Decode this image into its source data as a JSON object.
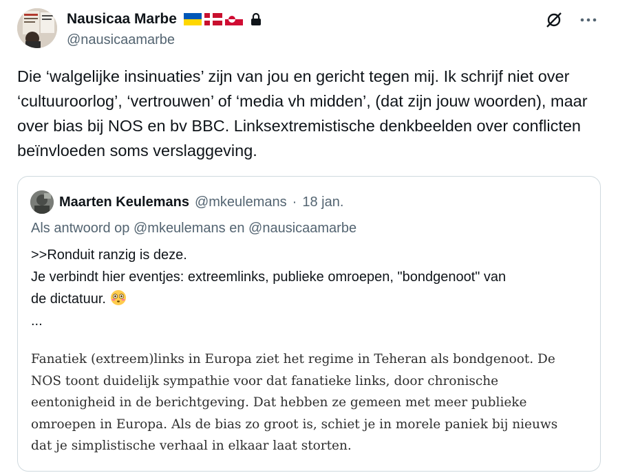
{
  "author": {
    "name": "Nausicaa Marbe",
    "handle": "@nausicaamarbe",
    "flags": [
      "ukraine-flag",
      "denmark-flag",
      "greenland-flag"
    ],
    "protected": true
  },
  "tweet": {
    "text": "Die ‘walgelijke insinuaties’ zijn van jou en gericht tegen mij. Ik schrijf niet over ‘cultuuroorlog’, ‘vertrouwen’ of ‘media vh midden’, (dat zijn jouw woorden), maar over bias bij NOS en bv BBC. Linksextremistische denkbeelden over conflicten beïnvloeden soms verslaggeving."
  },
  "quote": {
    "name": "Maarten Keulemans",
    "handle": "@mkeulemans",
    "separator": "·",
    "date": "18 jan.",
    "reply_to": "Als antwoord op @mkeulemans en @nausicaamarbe",
    "lines": [
      ">>Ronduit ranzig is deze.",
      "Je verbindt hier eventjes: extreemlinks, publieke omroepen, \"bondgenoot\" van",
      "de dictatuur.",
      "..."
    ],
    "emoji": "flushed-face",
    "image_text": [
      "Fanatiek (extreem)links in Europa ziet het regime in Teheran als bondgenoot. De",
      "NOS toont duidelijk sympathie voor dat fanatieke links, door chronische",
      "eentonigheid in de berichtgeving. Dat hebben ze gemeen met meer publieke",
      "omroepen in Europa. Als de bias zo groot is, schiet je in morele paniek bij nieuws",
      "dat je simplistische verhaal in elkaar laat storten."
    ]
  },
  "colors": {
    "text": "#0f1419",
    "secondary": "#536471",
    "border": "#cfd9de"
  }
}
